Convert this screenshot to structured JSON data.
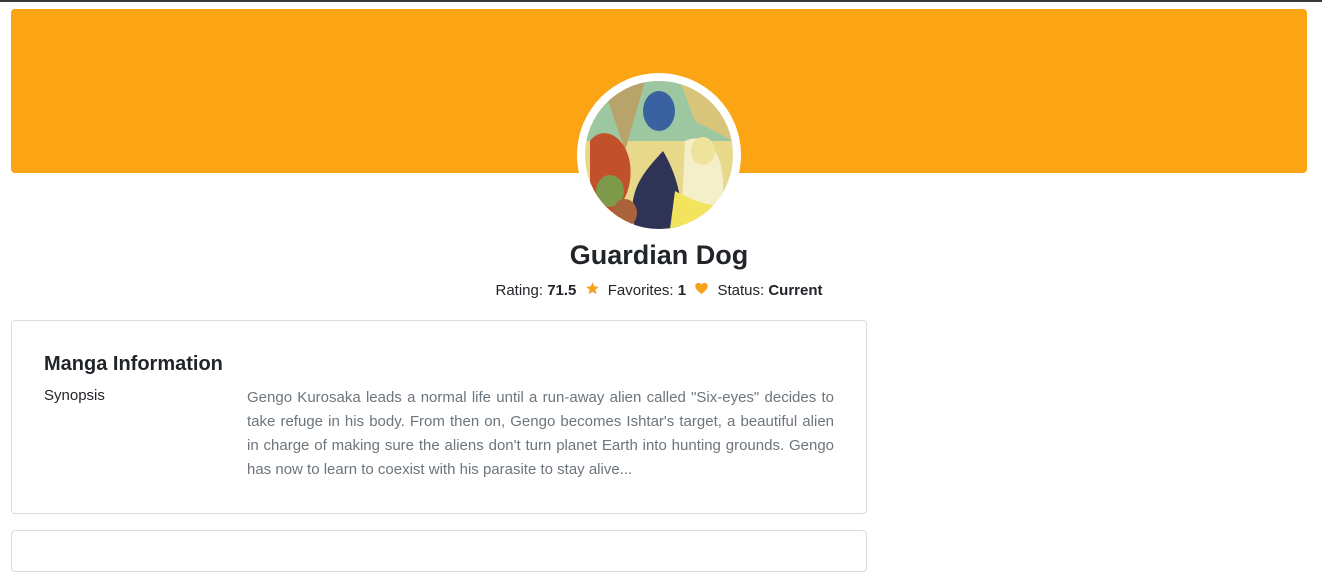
{
  "manga": {
    "title": "Guardian Dog",
    "rating_label": "Rating:",
    "rating_value": "71.5",
    "favorites_label": "Favorites:",
    "favorites_value": "1",
    "status_label": "Status:",
    "status_value": "Current"
  },
  "info_card": {
    "heading": "Manga Information",
    "synopsis_label": "Synopsis",
    "synopsis_text": "Gengo Kurosaka leads a normal life until a run-away alien called \"Six-eyes\" decides to take refuge in his body. From then on, Gengo becomes Ishtar's target, a beautiful alien in charge of making sure the aliens don't turn planet Earth into hunting grounds. Gengo has now to learn to coexist with his parasite to stay alive..."
  },
  "icons": {
    "rating": "star-icon",
    "favorites": "heart-icon"
  },
  "colors": {
    "banner": "#fba514",
    "accent": "#f6a21a",
    "muted_text": "#6c757d"
  }
}
